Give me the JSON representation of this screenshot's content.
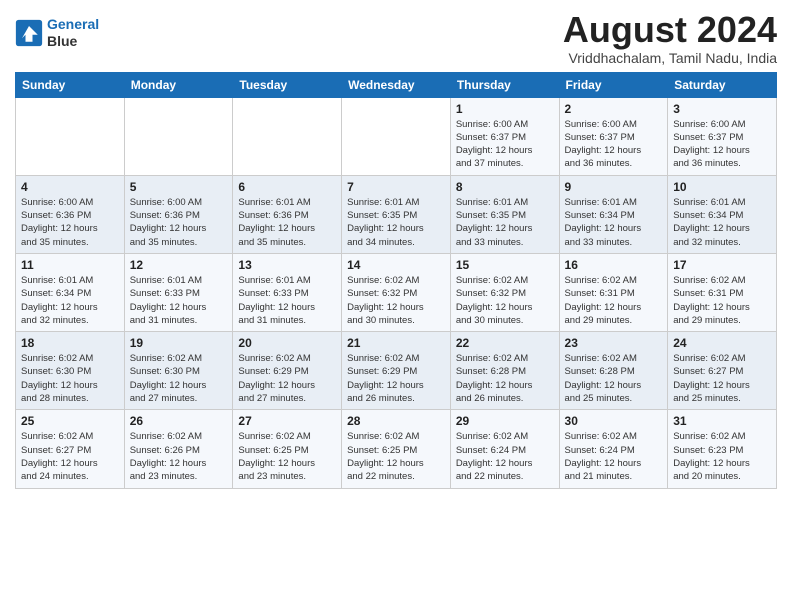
{
  "header": {
    "logo_line1": "General",
    "logo_line2": "Blue",
    "title": "August 2024",
    "subtitle": "Vriddhachalam, Tamil Nadu, India"
  },
  "weekdays": [
    "Sunday",
    "Monday",
    "Tuesday",
    "Wednesday",
    "Thursday",
    "Friday",
    "Saturday"
  ],
  "weeks": [
    [
      {
        "day": "",
        "info": ""
      },
      {
        "day": "",
        "info": ""
      },
      {
        "day": "",
        "info": ""
      },
      {
        "day": "",
        "info": ""
      },
      {
        "day": "1",
        "info": "Sunrise: 6:00 AM\nSunset: 6:37 PM\nDaylight: 12 hours\nand 37 minutes."
      },
      {
        "day": "2",
        "info": "Sunrise: 6:00 AM\nSunset: 6:37 PM\nDaylight: 12 hours\nand 36 minutes."
      },
      {
        "day": "3",
        "info": "Sunrise: 6:00 AM\nSunset: 6:37 PM\nDaylight: 12 hours\nand 36 minutes."
      }
    ],
    [
      {
        "day": "4",
        "info": "Sunrise: 6:00 AM\nSunset: 6:36 PM\nDaylight: 12 hours\nand 35 minutes."
      },
      {
        "day": "5",
        "info": "Sunrise: 6:00 AM\nSunset: 6:36 PM\nDaylight: 12 hours\nand 35 minutes."
      },
      {
        "day": "6",
        "info": "Sunrise: 6:01 AM\nSunset: 6:36 PM\nDaylight: 12 hours\nand 35 minutes."
      },
      {
        "day": "7",
        "info": "Sunrise: 6:01 AM\nSunset: 6:35 PM\nDaylight: 12 hours\nand 34 minutes."
      },
      {
        "day": "8",
        "info": "Sunrise: 6:01 AM\nSunset: 6:35 PM\nDaylight: 12 hours\nand 33 minutes."
      },
      {
        "day": "9",
        "info": "Sunrise: 6:01 AM\nSunset: 6:34 PM\nDaylight: 12 hours\nand 33 minutes."
      },
      {
        "day": "10",
        "info": "Sunrise: 6:01 AM\nSunset: 6:34 PM\nDaylight: 12 hours\nand 32 minutes."
      }
    ],
    [
      {
        "day": "11",
        "info": "Sunrise: 6:01 AM\nSunset: 6:34 PM\nDaylight: 12 hours\nand 32 minutes."
      },
      {
        "day": "12",
        "info": "Sunrise: 6:01 AM\nSunset: 6:33 PM\nDaylight: 12 hours\nand 31 minutes."
      },
      {
        "day": "13",
        "info": "Sunrise: 6:01 AM\nSunset: 6:33 PM\nDaylight: 12 hours\nand 31 minutes."
      },
      {
        "day": "14",
        "info": "Sunrise: 6:02 AM\nSunset: 6:32 PM\nDaylight: 12 hours\nand 30 minutes."
      },
      {
        "day": "15",
        "info": "Sunrise: 6:02 AM\nSunset: 6:32 PM\nDaylight: 12 hours\nand 30 minutes."
      },
      {
        "day": "16",
        "info": "Sunrise: 6:02 AM\nSunset: 6:31 PM\nDaylight: 12 hours\nand 29 minutes."
      },
      {
        "day": "17",
        "info": "Sunrise: 6:02 AM\nSunset: 6:31 PM\nDaylight: 12 hours\nand 29 minutes."
      }
    ],
    [
      {
        "day": "18",
        "info": "Sunrise: 6:02 AM\nSunset: 6:30 PM\nDaylight: 12 hours\nand 28 minutes."
      },
      {
        "day": "19",
        "info": "Sunrise: 6:02 AM\nSunset: 6:30 PM\nDaylight: 12 hours\nand 27 minutes."
      },
      {
        "day": "20",
        "info": "Sunrise: 6:02 AM\nSunset: 6:29 PM\nDaylight: 12 hours\nand 27 minutes."
      },
      {
        "day": "21",
        "info": "Sunrise: 6:02 AM\nSunset: 6:29 PM\nDaylight: 12 hours\nand 26 minutes."
      },
      {
        "day": "22",
        "info": "Sunrise: 6:02 AM\nSunset: 6:28 PM\nDaylight: 12 hours\nand 26 minutes."
      },
      {
        "day": "23",
        "info": "Sunrise: 6:02 AM\nSunset: 6:28 PM\nDaylight: 12 hours\nand 25 minutes."
      },
      {
        "day": "24",
        "info": "Sunrise: 6:02 AM\nSunset: 6:27 PM\nDaylight: 12 hours\nand 25 minutes."
      }
    ],
    [
      {
        "day": "25",
        "info": "Sunrise: 6:02 AM\nSunset: 6:27 PM\nDaylight: 12 hours\nand 24 minutes."
      },
      {
        "day": "26",
        "info": "Sunrise: 6:02 AM\nSunset: 6:26 PM\nDaylight: 12 hours\nand 23 minutes."
      },
      {
        "day": "27",
        "info": "Sunrise: 6:02 AM\nSunset: 6:25 PM\nDaylight: 12 hours\nand 23 minutes."
      },
      {
        "day": "28",
        "info": "Sunrise: 6:02 AM\nSunset: 6:25 PM\nDaylight: 12 hours\nand 22 minutes."
      },
      {
        "day": "29",
        "info": "Sunrise: 6:02 AM\nSunset: 6:24 PM\nDaylight: 12 hours\nand 22 minutes."
      },
      {
        "day": "30",
        "info": "Sunrise: 6:02 AM\nSunset: 6:24 PM\nDaylight: 12 hours\nand 21 minutes."
      },
      {
        "day": "31",
        "info": "Sunrise: 6:02 AM\nSunset: 6:23 PM\nDaylight: 12 hours\nand 20 minutes."
      }
    ]
  ]
}
